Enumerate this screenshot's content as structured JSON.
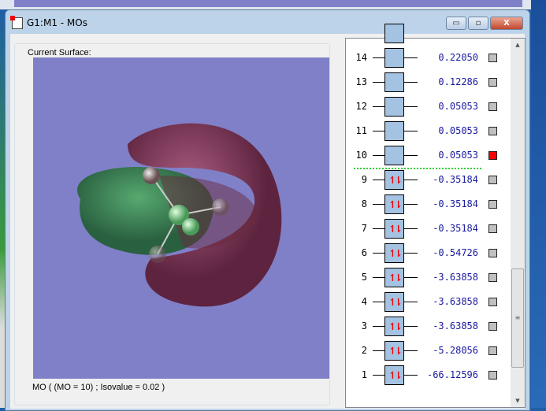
{
  "window": {
    "title": "G1:M1 - MOs",
    "minimize": "▭",
    "maximize": "▫",
    "close": "X"
  },
  "surface": {
    "label": "Current Surface:",
    "status": "MO ( (MO = 10) ; Isovalue = 0.02 )"
  },
  "colors": {
    "viewport": "#8080c8",
    "positive_lobe": "#8a2a4a",
    "negative_lobe": "#2a8a3a",
    "occupied_arrows": "#e00000",
    "selected": "#ff0000"
  },
  "orbitals": [
    {
      "n": "14",
      "energy": "0.22050",
      "occupied": false,
      "selected": false
    },
    {
      "n": "13",
      "energy": "0.12286",
      "occupied": false,
      "selected": false
    },
    {
      "n": "12",
      "energy": "0.05053",
      "occupied": false,
      "selected": false
    },
    {
      "n": "11",
      "energy": "0.05053",
      "occupied": false,
      "selected": false
    },
    {
      "n": "10",
      "energy": "0.05053",
      "occupied": false,
      "selected": true
    },
    {
      "n": "9",
      "energy": "-0.35184",
      "occupied": true,
      "selected": false
    },
    {
      "n": "8",
      "energy": "-0.35184",
      "occupied": true,
      "selected": false
    },
    {
      "n": "7",
      "energy": "-0.35184",
      "occupied": true,
      "selected": false
    },
    {
      "n": "6",
      "energy": "-0.54726",
      "occupied": true,
      "selected": false
    },
    {
      "n": "5",
      "energy": "-3.63858",
      "occupied": true,
      "selected": false
    },
    {
      "n": "4",
      "energy": "-3.63858",
      "occupied": true,
      "selected": false
    },
    {
      "n": "3",
      "energy": "-3.63858",
      "occupied": true,
      "selected": false
    },
    {
      "n": "2",
      "energy": "-5.28056",
      "occupied": true,
      "selected": false
    },
    {
      "n": "1",
      "energy": "-66.12596",
      "occupied": true,
      "selected": false
    }
  ],
  "occupied_glyph": "↿⇂"
}
